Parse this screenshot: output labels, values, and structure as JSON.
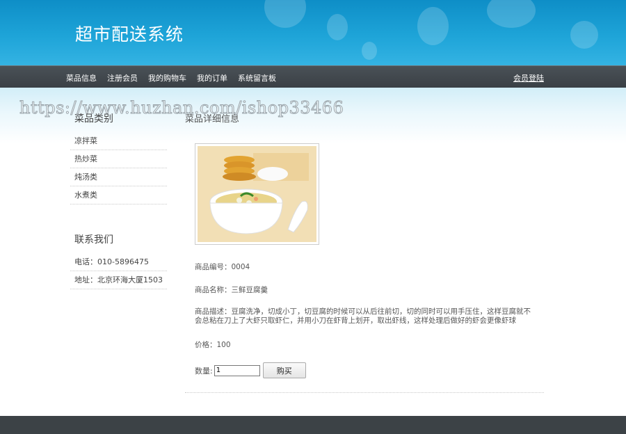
{
  "header": {
    "site_title": "超市配送系统"
  },
  "nav": {
    "items": [
      {
        "label": "菜品信息"
      },
      {
        "label": "注册会员"
      },
      {
        "label": "我的购物车"
      },
      {
        "label": "我的订单"
      },
      {
        "label": "系统留言板"
      }
    ],
    "login_label": "会员登陆"
  },
  "watermark": "https://www.huzhan.com/ishop33466",
  "sidebar": {
    "category_heading": "菜品类别",
    "categories": [
      {
        "label": "凉拌菜"
      },
      {
        "label": "热炒菜"
      },
      {
        "label": "炖汤类"
      },
      {
        "label": "水煮类"
      }
    ],
    "contact_heading": "联系我们",
    "contacts": [
      {
        "text": "电话：010-5896475"
      },
      {
        "text": "地址：北京环海大厦1503"
      }
    ]
  },
  "main": {
    "heading": "菜品详细信息",
    "product": {
      "id_text": "商品编号：0004",
      "name_text": "商品名称：三鲜豆腐羹",
      "desc_text": "商品描述：豆腐洗净，切成小丁，切豆腐的时候可以从后往前切，切的同时可以用手压住，这样豆腐就不会总粘在刀上了大虾只取虾仁，并用小刀在虾背上划开，取出虾线，这样处理后做好的虾会更像虾球",
      "price_text": "价格：100"
    },
    "qty_label": "数量:",
    "qty_value": "1",
    "buy_label": "购买"
  }
}
